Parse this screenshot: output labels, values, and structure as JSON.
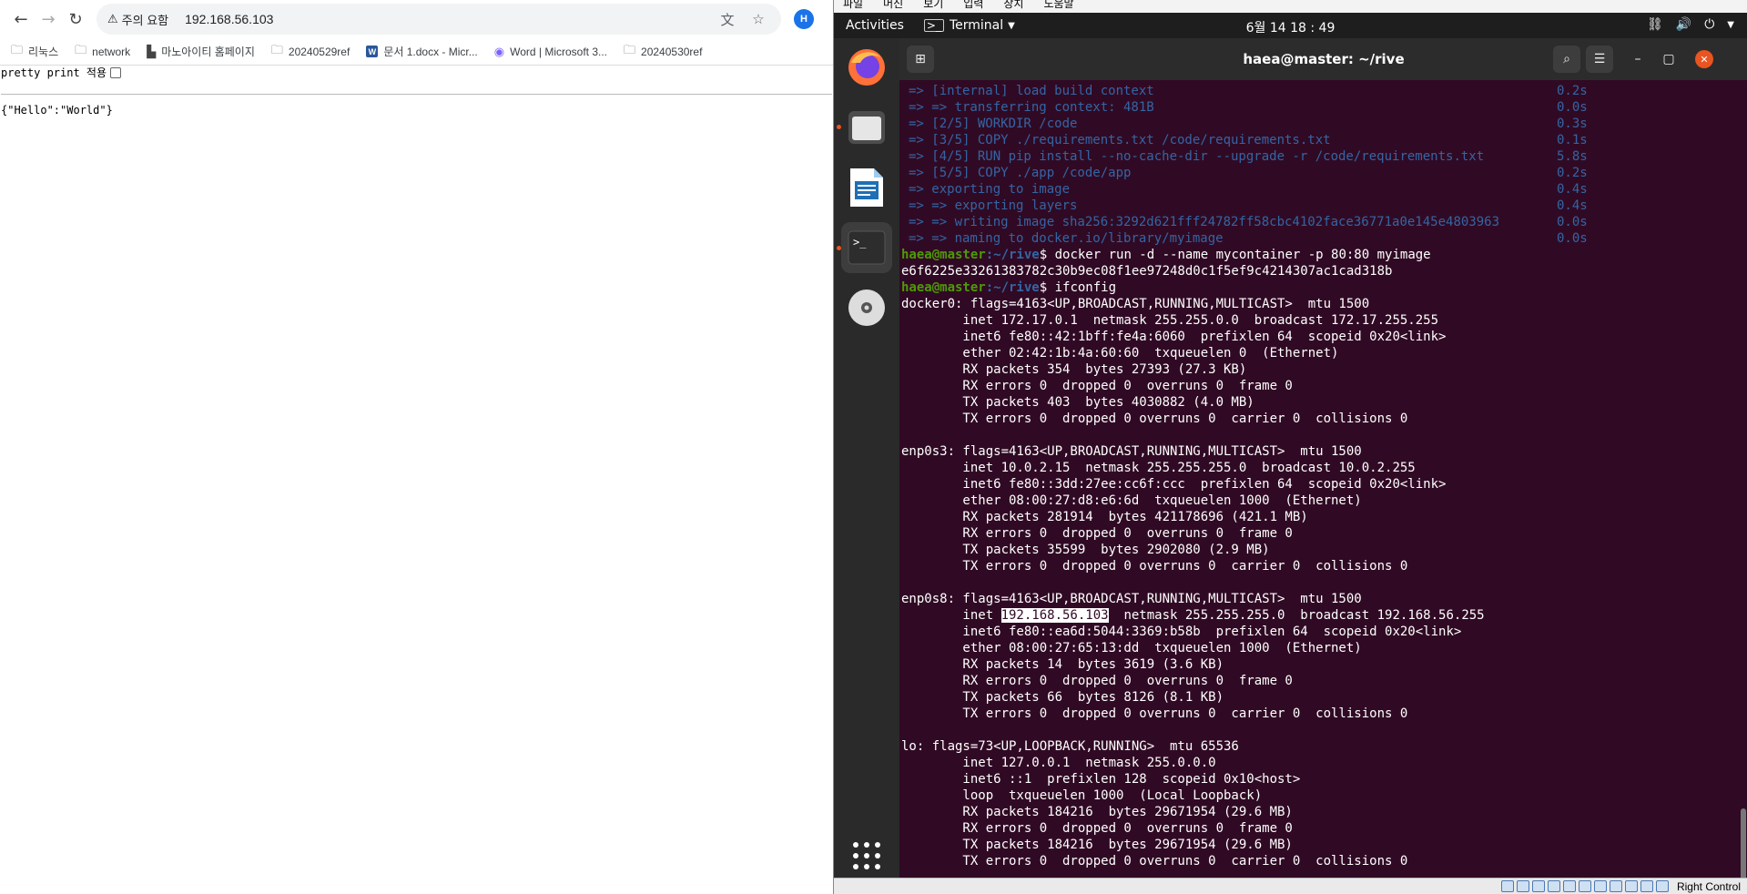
{
  "browser": {
    "security_label": "주의 요함",
    "url": "192.168.56.103",
    "profile_initial": "H",
    "bookmarks": [
      {
        "label": "리눅스",
        "icon": "folder-icon"
      },
      {
        "label": "network",
        "icon": "folder-icon"
      },
      {
        "label": "마노아이티 홈페이지",
        "icon": "page-icon"
      },
      {
        "label": "20240529ref",
        "icon": "folder-icon"
      },
      {
        "label": "문서 1.docx - Micr...",
        "icon": "word-icon"
      },
      {
        "label": "Word | Microsoft 3...",
        "icon": "microsoft-icon"
      },
      {
        "label": "20240530ref",
        "icon": "folder-icon"
      }
    ],
    "pretty_print_label": "pretty print 적용",
    "json_body": "{\"Hello\":\"World\"}"
  },
  "vbox_menu": [
    "파일",
    "머신",
    "보기",
    "입력",
    "장치",
    "도움말"
  ],
  "gnome": {
    "activities": "Activities",
    "app_name": "Terminal",
    "clock": "6월 14 18 : 49"
  },
  "terminal": {
    "title": "haea@master: ~/rive",
    "build_lines": [
      {
        "text": "=> [internal] load build context",
        "time": "0.2s"
      },
      {
        "text": "=> => transferring context: 481B",
        "time": "0.0s"
      },
      {
        "text": "=> [2/5] WORKDIR /code",
        "time": "0.3s"
      },
      {
        "text": "=> [3/5] COPY ./requirements.txt /code/requirements.txt",
        "time": "0.1s"
      },
      {
        "text": "=> [4/5] RUN pip install --no-cache-dir --upgrade -r /code/requirements.txt",
        "time": "5.8s"
      },
      {
        "text": "=> [5/5] COPY ./app /code/app",
        "time": "0.2s"
      },
      {
        "text": "=> exporting to image",
        "time": "0.4s"
      },
      {
        "text": "=> => exporting layers",
        "time": "0.4s"
      },
      {
        "text": "=> => writing image sha256:3292d621fff24782ff58cbc4102face36771a0e145e4803963",
        "time": "0.0s"
      },
      {
        "text": "=> => naming to docker.io/library/myimage",
        "time": "0.0s"
      }
    ],
    "prompt_user": "haea@master",
    "prompt_path": ":~/rive",
    "cmd1": "$ docker run -d --name mycontainer -p 80:80 myimage",
    "container_id": "e6f6225e33261383782c30b9ec08f1ee97248d0c1f5ef9c4214307ac1cad318b",
    "cmd2": "$ ifconfig",
    "docker0": [
      "docker0: flags=4163<UP,BROADCAST,RUNNING,MULTICAST>  mtu 1500",
      "        inet 172.17.0.1  netmask 255.255.0.0  broadcast 172.17.255.255",
      "        inet6 fe80::42:1bff:fe4a:6060  prefixlen 64  scopeid 0x20<link>",
      "        ether 02:42:1b:4a:60:60  txqueuelen 0  (Ethernet)",
      "        RX packets 354  bytes 27393 (27.3 KB)",
      "        RX errors 0  dropped 0  overruns 0  frame 0",
      "        TX packets 403  bytes 4030882 (4.0 MB)",
      "        TX errors 0  dropped 0 overruns 0  carrier 0  collisions 0"
    ],
    "enp0s3": [
      "enp0s3: flags=4163<UP,BROADCAST,RUNNING,MULTICAST>  mtu 1500",
      "        inet 10.0.2.15  netmask 255.255.255.0  broadcast 10.0.2.255",
      "        inet6 fe80::3dd:27ee:cc6f:ccc  prefixlen 64  scopeid 0x20<link>",
      "        ether 08:00:27:d8:e6:6d  txqueuelen 1000  (Ethernet)",
      "        RX packets 281914  bytes 421178696 (421.1 MB)",
      "        RX errors 0  dropped 0  overruns 0  frame 0",
      "        TX packets 35599  bytes 2902080 (2.9 MB)",
      "        TX errors 0  dropped 0 overruns 0  carrier 0  collisions 0"
    ],
    "enp0s8_head": "enp0s8: flags=4163<UP,BROADCAST,RUNNING,MULTICAST>  mtu 1500",
    "enp0s8_inet_prefix": "        inet ",
    "enp0s8_inet_ip": "192.168.56.103",
    "enp0s8_inet_rest": "  netmask 255.255.255.0  broadcast 192.168.56.255",
    "enp0s8": [
      "        inet6 fe80::ea6d:5044:3369:b58b  prefixlen 64  scopeid 0x20<link>",
      "        ether 08:00:27:65:13:dd  txqueuelen 1000  (Ethernet)",
      "        RX packets 14  bytes 3619 (3.6 KB)",
      "        RX errors 0  dropped 0  overruns 0  frame 0",
      "        TX packets 66  bytes 8126 (8.1 KB)",
      "        TX errors 0  dropped 0 overruns 0  carrier 0  collisions 0"
    ],
    "lo": [
      "lo: flags=73<UP,LOOPBACK,RUNNING>  mtu 65536",
      "        inet 127.0.0.1  netmask 255.0.0.0",
      "        inet6 ::1  prefixlen 128  scopeid 0x10<host>",
      "        loop  txqueuelen 1000  (Local Loopback)",
      "        RX packets 184216  bytes 29671954 (29.6 MB)",
      "        RX errors 0  dropped 0  overruns 0  frame 0",
      "        TX packets 184216  bytes 29671954 (29.6 MB)",
      "        TX errors 0  dropped 0 overruns 0  carrier 0  collisions 0"
    ]
  },
  "vbox_status": {
    "host_key": "Right Control"
  },
  "colors": {
    "terminal_bg": "#300a24",
    "prompt_user": "#4e9a06",
    "prompt_path": "#3465a4",
    "ubuntu_orange": "#e95420"
  }
}
